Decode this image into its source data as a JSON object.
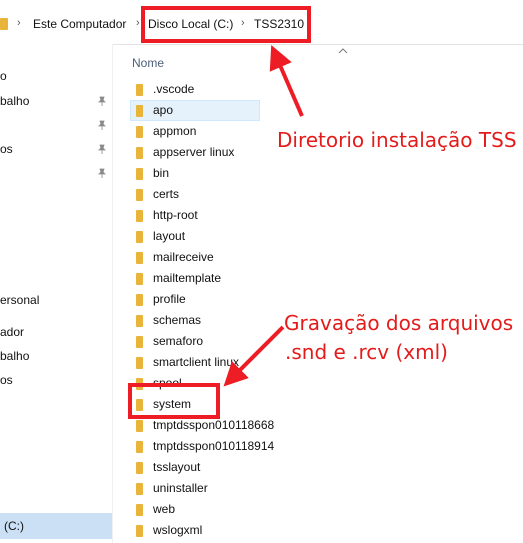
{
  "breadcrumb": {
    "items": [
      "Este Computador",
      "Disco Local (C:)",
      "TSS2310"
    ],
    "separator": ">"
  },
  "navigation": {
    "items": [
      "o",
      "balho",
      "os",
      "ersonal",
      "ador",
      "balho",
      "os",
      "(C:)"
    ],
    "selected_item": "(C:)",
    "pinned_count": 4
  },
  "file_list": {
    "column_header": "Nome",
    "folders": [
      ".vscode",
      "apo",
      "appmon",
      "appserver linux",
      "bin",
      "certs",
      "http-root",
      "layout",
      "mailreceive",
      "mailtemplate",
      "profile",
      "schemas",
      "semaforo",
      "smartclient linux",
      "spool",
      "system",
      "tmptdsspon010118668",
      "tmptdsspon010118914",
      "tsslayout",
      "uninstaller",
      "web",
      "wslogxml"
    ],
    "highlighted_folder": "apo"
  },
  "annotations": {
    "install_dir_label": "Diretorio instalação TSS",
    "recording_label_line1": "Gravação dos arquivos",
    "recording_label_line2": ".snd e .rcv (xml)"
  },
  "colors": {
    "annotation_red": "#ee1c24",
    "folder_yellow": "#e8b53a",
    "selection_blue": "#cce0f5"
  }
}
